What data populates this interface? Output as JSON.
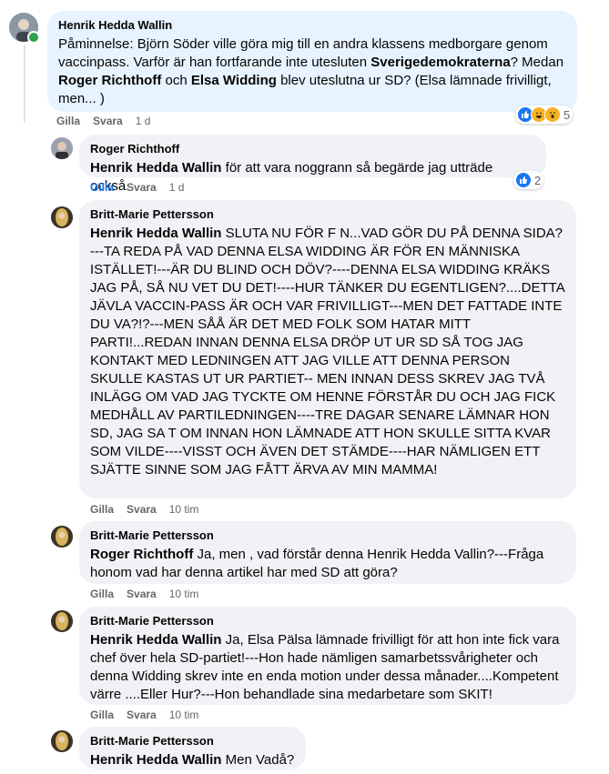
{
  "comments": [
    {
      "author": "Henrik Hedda Wallin",
      "segments": [
        {
          "text": "Påminnelse: Björn Söder ville göra mig till en andra klassens medborgare genom vaccinpass. Varför är han fortfarande inte utesluten ",
          "bold": false
        },
        {
          "text": "Sverigedemokraterna",
          "bold": true
        },
        {
          "text": "? Medan ",
          "bold": false
        },
        {
          "text": "Roger Richthoff",
          "bold": true
        },
        {
          "text": " och ",
          "bold": false
        },
        {
          "text": "Elsa Widding",
          "bold": true
        },
        {
          "text": " blev uteslutna ur SD? (Elsa lämnade frivilligt, men... )",
          "bold": false
        }
      ],
      "like": "Gilla",
      "reply": "Svara",
      "time": "1 d",
      "reactions": {
        "icons": [
          "like-icon",
          "haha-icon",
          "wow-icon"
        ],
        "count": "5"
      }
    },
    {
      "author": "Roger Richthoff",
      "segments": [
        {
          "text": "Henrik Hedda Wallin",
          "bold": true
        },
        {
          "text": " för att vara noggrann så begärde jag utträde också.",
          "bold": false
        }
      ],
      "like": "Gilla",
      "reply": "Svara",
      "time": "1 d",
      "reactions": {
        "icons": [
          "like-icon"
        ],
        "count": "2"
      }
    },
    {
      "author": "Britt-Marie Pettersson",
      "segments": [
        {
          "text": "Henrik Hedda Wallin",
          "bold": true
        },
        {
          "text": " SLUTA NU FÖR F N...VAD GÖR DU PÅ DENNA SIDA?---TA REDA PÅ VAD DENNA ELSA WIDDING ÄR FÖR EN MÄNNISKA ISTÄLLET!---ÄR DU BLIND OCH DÖV?----DENNA ELSA WIDDING KRÄKS JAG PÅ, SÅ NU VET DU DET!----HUR TÄNKER DU EGENTLIGEN?....DETTA JÄVLA VACCIN-PASS ÄR OCH VAR FRIVILLIGT---MEN DET FATTADE INTE DU VA?!?---MEN SÅÅ ÄR DET MED FOLK SOM HATAR MITT PARTI!...REDAN INNAN DENNA ELSA DRÖP UT UR SD SÅ TOG JAG KONTAKT MED LEDNINGEN ATT JAG VILLE ATT DENNA PERSON SKULLE KASTAS UT UR PARTIET-- MEN INNAN DESS SKREV JAG TVÅ INLÄGG OM VAD JAG TYCKTE OM HENNE FÖRSTÅR DU OCH JAG FICK MEDHÅLL AV PARTILEDNINGEN----TRE DAGAR SENARE LÄMNAR HON SD, JAG SA T OM INNAN HON LÄMNADE ATT HON SKULLE SITTA KVAR SOM VILDE----VISST OCH ÄVEN DET STÄMDE----HAR NÄMLIGEN ETT SJÄTTE SINNE SOM JAG FÅTT ÄRVA AV MIN MAMMA!",
          "bold": false
        }
      ],
      "like": "Gilla",
      "reply": "Svara",
      "time": "10 tim"
    },
    {
      "author": "Britt-Marie Pettersson",
      "segments": [
        {
          "text": "Roger Richthoff",
          "bold": true
        },
        {
          "text": " Ja, men , vad förstår denna Henrik Hedda Vallin?---Fråga honom vad har denna artikel har med SD att göra?",
          "bold": false
        }
      ],
      "like": "Gilla",
      "reply": "Svara",
      "time": "10 tim"
    },
    {
      "author": "Britt-Marie Pettersson",
      "segments": [
        {
          "text": "Henrik Hedda Wallin",
          "bold": true
        },
        {
          "text": " Ja, Elsa Pälsa lämnade frivilligt för att hon inte fick vara chef över hela SD-partiet!---Hon hade nämligen samarbetssvårigheter och denna Widding skrev inte en enda motion under dessa månader....Kompetent värre ....Eller Hur?---Hon behandlade sina medarbetare som SKIT!",
          "bold": false
        }
      ],
      "like": "Gilla",
      "reply": "Svara",
      "time": "10 tim"
    },
    {
      "author": "Britt-Marie Pettersson",
      "segments": [
        {
          "text": "Henrik Hedda Wallin",
          "bold": true
        },
        {
          "text": " Men Vadå?",
          "bold": false
        }
      ]
    }
  ],
  "colors": {
    "bubble": "#f0f2f5",
    "highlight": "#e7f3ff",
    "meta": "#65676b",
    "liked": "#1877f2",
    "online": "#31a24c"
  }
}
